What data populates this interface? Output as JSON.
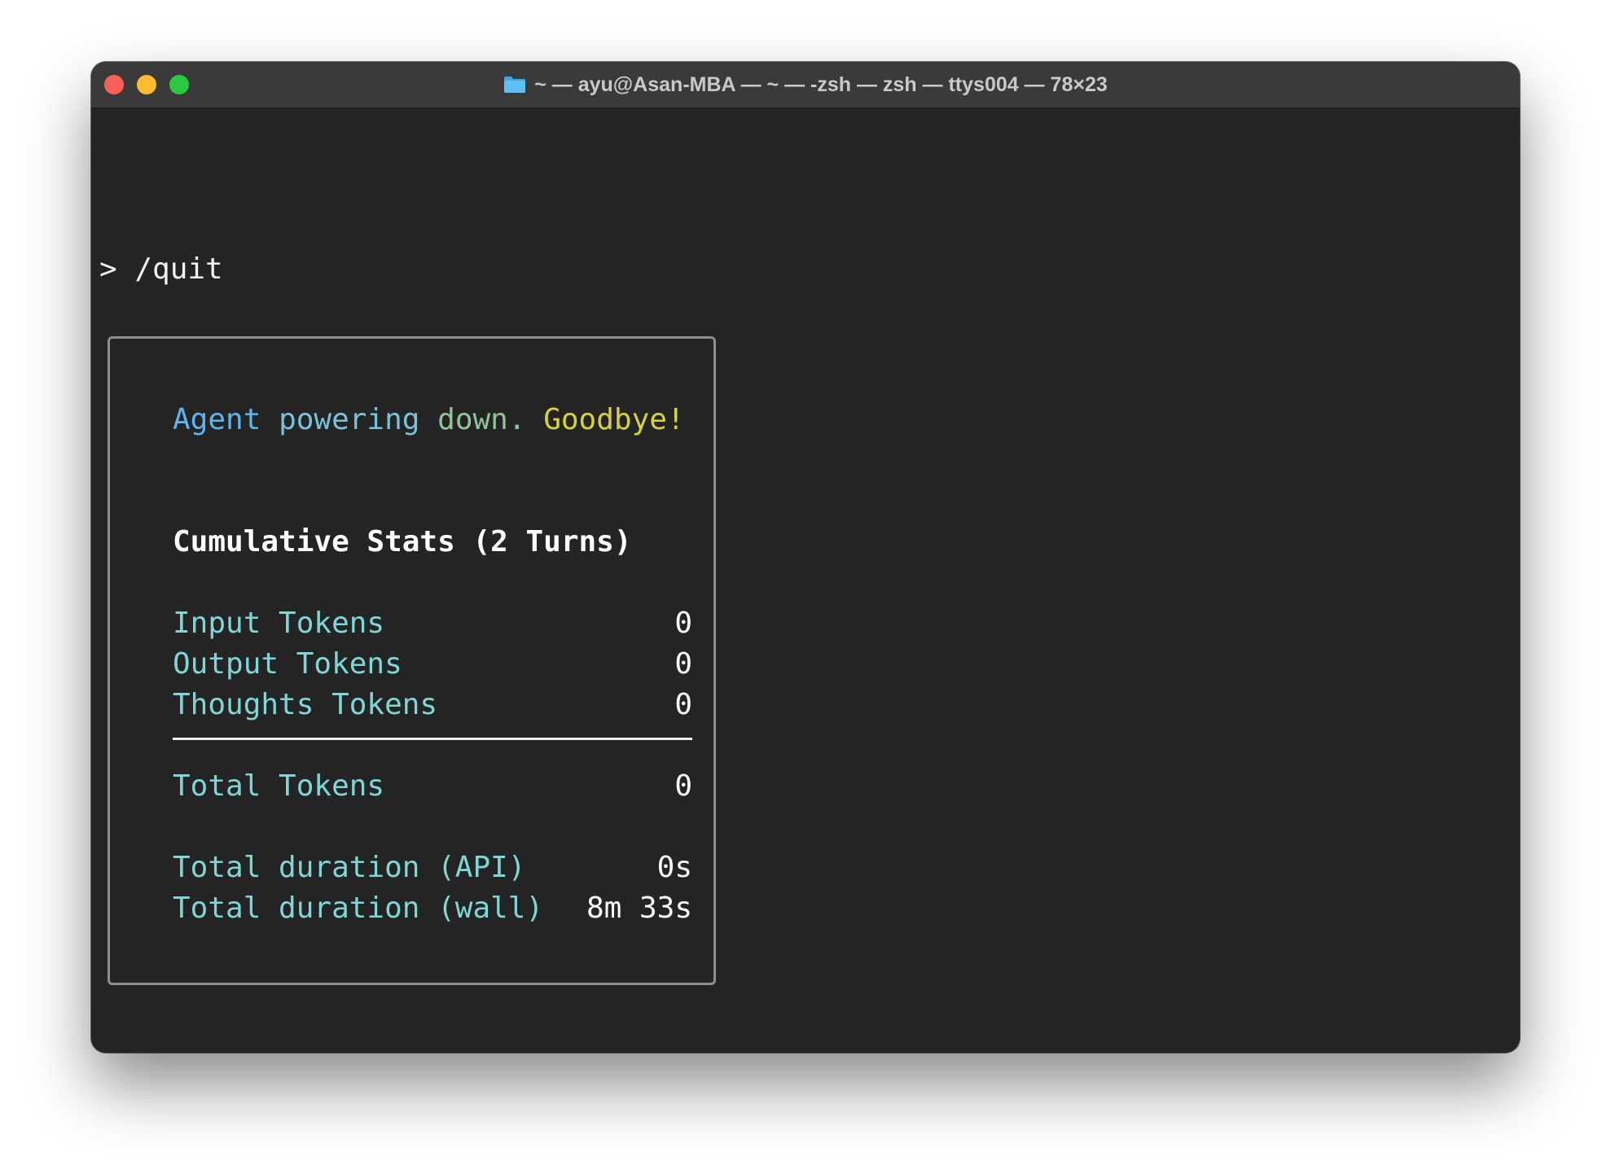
{
  "window": {
    "title": "~ — ayu@Asan-MBA — ~ — -zsh — zsh — ttys004 — 78×23",
    "icon": "folder-icon"
  },
  "terminal": {
    "prompt": "> /quit",
    "goodbye": {
      "agent": "Agent",
      "powering": "powering",
      "down": "down.",
      "goodbye": "Goodbye!"
    },
    "stats_title": "Cumulative Stats (2 Turns)",
    "tokens": [
      {
        "label": "Input Tokens",
        "value": "0"
      },
      {
        "label": "Output Tokens",
        "value": "0"
      },
      {
        "label": "Thoughts Tokens",
        "value": "0"
      }
    ],
    "total": {
      "label": "Total Tokens",
      "value": "0"
    },
    "durations": [
      {
        "label": "Total duration (API)",
        "value": "0s"
      },
      {
        "label": "Total duration (wall)",
        "value": "8m 33s"
      }
    ]
  },
  "colors": {
    "background": "#242424",
    "label": "#7fd6d6",
    "border": "#8e8e8e"
  }
}
